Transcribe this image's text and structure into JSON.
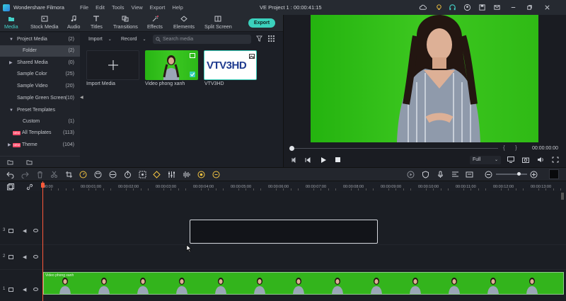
{
  "app": {
    "name": "Wondershare Filmora",
    "project_title": "VE Project 1 : 00:00:41:15"
  },
  "menu": [
    "File",
    "Edit",
    "Tools",
    "View",
    "Export",
    "Help"
  ],
  "tabs": [
    {
      "label": "Media",
      "icon": "folder-icon"
    },
    {
      "label": "Stock Media",
      "icon": "stock-media-icon"
    },
    {
      "label": "Audio",
      "icon": "music-note-icon"
    },
    {
      "label": "Titles",
      "icon": "text-icon"
    },
    {
      "label": "Transitions",
      "icon": "transitions-icon"
    },
    {
      "label": "Effects",
      "icon": "effects-icon"
    },
    {
      "label": "Elements",
      "icon": "elements-icon"
    },
    {
      "label": "Split Screen",
      "icon": "split-screen-icon"
    }
  ],
  "export_label": "Export",
  "sidebar": {
    "items": [
      {
        "label": "Project Media",
        "count": "(2)"
      },
      {
        "label": "Folder",
        "count": "(2)"
      },
      {
        "label": "Shared Media",
        "count": "(0)"
      },
      {
        "label": "Sample Color",
        "count": "(25)"
      },
      {
        "label": "Sample Video",
        "count": "(20)"
      },
      {
        "label": "Sample Green Screen",
        "count": "(10)"
      },
      {
        "label": "Preset Templates",
        "count": ""
      },
      {
        "label": "Custom",
        "count": "(1)"
      },
      {
        "label": "All Templates",
        "count": "(113)"
      },
      {
        "label": "Theme",
        "count": "(104)"
      }
    ],
    "new_tag": "NEW"
  },
  "library": {
    "import_dropdown": "Import",
    "record_dropdown": "Record",
    "search_placeholder": "Search media",
    "items": [
      {
        "label": "Import Media"
      },
      {
        "label": "Video phong xanh"
      },
      {
        "label": "VTV3HD"
      }
    ],
    "vtv_logo_text": "VTV3HD"
  },
  "preview": {
    "timecode": "00:00:00:00",
    "quality": "Full",
    "bracket_in": "{",
    "bracket_out": "}"
  },
  "timeline": {
    "ruler": [
      "00:00",
      "00:00:01:00",
      "00:00:02:00",
      "00:00:03:00",
      "00:00:04:00",
      "00:00:05:00",
      "00:00:06:00",
      "00:00:07:00",
      "00:00:08:00",
      "00:00:09:00",
      "00:00:10:00",
      "00:00:11:00",
      "00:00:12:00",
      "00:00:13:00"
    ],
    "tracks": [
      {
        "num": "3"
      },
      {
        "num": "2"
      },
      {
        "num": "1"
      }
    ],
    "video_clip_label": "Video phong xanh"
  },
  "colors": {
    "accent": "#3bd1bd",
    "playhead": "#ff5a3a",
    "green_screen": "#3dc820"
  }
}
